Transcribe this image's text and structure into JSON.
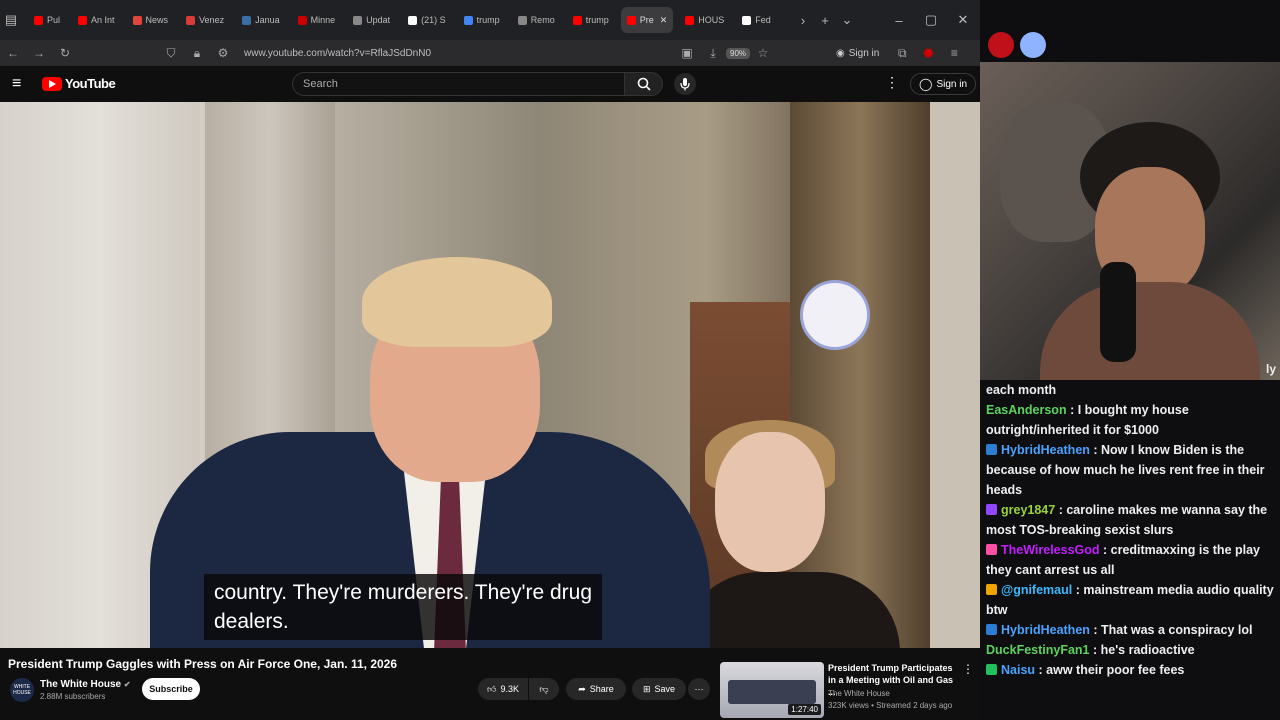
{
  "browser": {
    "tabs": [
      {
        "label": "Pul",
        "color": "#ff0000",
        "active": false
      },
      {
        "label": "An Int",
        "color": "#ff0000",
        "active": false
      },
      {
        "label": "News",
        "color": "#e2453c",
        "active": false
      },
      {
        "label": "Venez",
        "color": "#d93b3b",
        "active": false
      },
      {
        "label": "Janua",
        "color": "#3a6ea5",
        "active": false
      },
      {
        "label": "Minne",
        "color": "#cc0000",
        "active": false
      },
      {
        "label": "Updat",
        "color": "#888888",
        "active": false
      },
      {
        "label": "(21) S",
        "color": "#ffffff",
        "active": false
      },
      {
        "label": "trump",
        "color": "#4285f4",
        "active": false
      },
      {
        "label": "Remo",
        "color": "#888888",
        "active": false
      },
      {
        "label": "trump",
        "color": "#ff0000",
        "active": false
      },
      {
        "label": "Pre",
        "color": "#ff0000",
        "active": true
      },
      {
        "label": "HOUS",
        "color": "#ff0000",
        "active": false
      },
      {
        "label": "Fed",
        "color": "#ffffff",
        "active": false
      }
    ],
    "url": "www.youtube.com/watch?v=RflaJSdDnN0",
    "zoom": "90%",
    "sign_in": "Sign in"
  },
  "youtube": {
    "logo_text": "YouTube",
    "search_placeholder": "Search",
    "sign_in": "Sign in",
    "caption": "country. They're murderers. They're drug\ndealers.",
    "video_title": "President Trump Gaggles with Press on Air Force One, Jan. 11, 2026",
    "channel": {
      "name": "The White House",
      "subscribers": "2.88M subscribers",
      "avatar_text": "WHITE HOUSE",
      "subscribe_label": "Subscribe"
    },
    "actions": {
      "likes": "9.3K",
      "share": "Share",
      "save": "Save"
    },
    "recommendation": {
      "title": "President Trump Participates in a Meeting with Oil and Gas ...",
      "channel": "The White House",
      "views": "323K views • Streamed 2 days ago",
      "duration": "1:27:40"
    }
  },
  "chat": {
    "overflow_top": "each month",
    "cam_overlay_text": "ly",
    "messages": [
      {
        "user": "EasAnderson",
        "color": "#5dd35d",
        "badge": "",
        "text": "I bought my house outright/inherited it for $1000"
      },
      {
        "user": "HybridHeathen",
        "color": "#4aa3ff",
        "badge": "#2a7fd4",
        "text": "Now I know Biden is the because of how much he lives rent free in their heads"
      },
      {
        "user": "grey1847",
        "color": "#9ad23c",
        "badge": "#9147ff",
        "text": "caroline makes me wanna say the most TOS-breaking sexist slurs"
      },
      {
        "user": "TheWirelessGod",
        "color": "#c41eff",
        "badge": "#ff4fa3",
        "text": "creditmaxxing is the play they cant arrest us all"
      },
      {
        "user": "@gnifemaul",
        "color": "#3cb9ff",
        "badge": "#f0a500",
        "text": "mainstream media audio quality btw"
      },
      {
        "user": "HybridHeathen",
        "color": "#4aa3ff",
        "badge": "#2a7fd4",
        "text": "That was a conspiracy lol"
      },
      {
        "user": "DuckFestinyFan1",
        "color": "#5dd35d",
        "badge": "",
        "text": "he's radioactive"
      },
      {
        "user": "Naisu",
        "color": "#4aa3ff",
        "badge": "#21c05c",
        "text": "aww their poor fee fees"
      }
    ]
  },
  "colors": {
    "youtube_red": "#ff0000",
    "chat_bg": "#0e0e10",
    "browser_chrome": "#202124"
  }
}
